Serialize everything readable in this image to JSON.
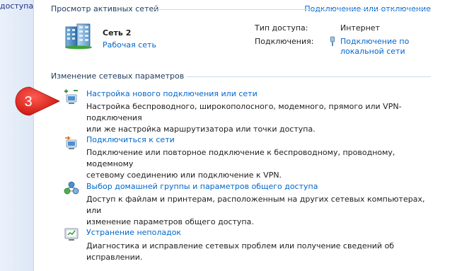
{
  "sidebar": {
    "link_fragment": "доступа"
  },
  "active_networks": {
    "header": "Просмотр активных сетей",
    "connect_link": "Подключение или отключение",
    "network_name": "Сеть  2",
    "network_type": "Рабочая сеть",
    "access_type_label": "Тип доступа:",
    "access_type_value": "Интернет",
    "connections_label": "Подключения:",
    "connection_line1": "Подключение по",
    "connection_line2": "локальной сети"
  },
  "change_settings": {
    "header": "Изменение сетевых параметров",
    "tasks": [
      {
        "icon": "new-connection-icon",
        "title": "Настройка нового подключения или сети",
        "desc_line1": "Настройка беспроводного, широкополосного, модемного, прямого или VPN-подключения",
        "desc_line2": "или же настройка маршрутизатора или точки доступа."
      },
      {
        "icon": "connect-network-icon",
        "title": "Подключиться к сети",
        "desc_line1": "Подключение или повторное подключение к беспроводному, проводному, модемному",
        "desc_line2": "сетевому соединению или подключение к VPN."
      },
      {
        "icon": "homegroup-icon",
        "title": "Выбор домашней группы и параметров общего доступа",
        "desc_line1": "Доступ к файлам и принтерам, расположенным на других сетевых компьютерах, или",
        "desc_line2": "изменение параметров общего доступа."
      },
      {
        "icon": "troubleshoot-icon",
        "title": "Устранение неполадок",
        "desc_line1": "Диагностика и исправление сетевых проблем или получение сведений об исправлении."
      }
    ]
  },
  "annotation": {
    "step_number": "3",
    "color": "#e8231f"
  },
  "colors": {
    "link": "#0066cc",
    "header": "#1e395b",
    "sidebar_bg": "#dde7f5"
  }
}
